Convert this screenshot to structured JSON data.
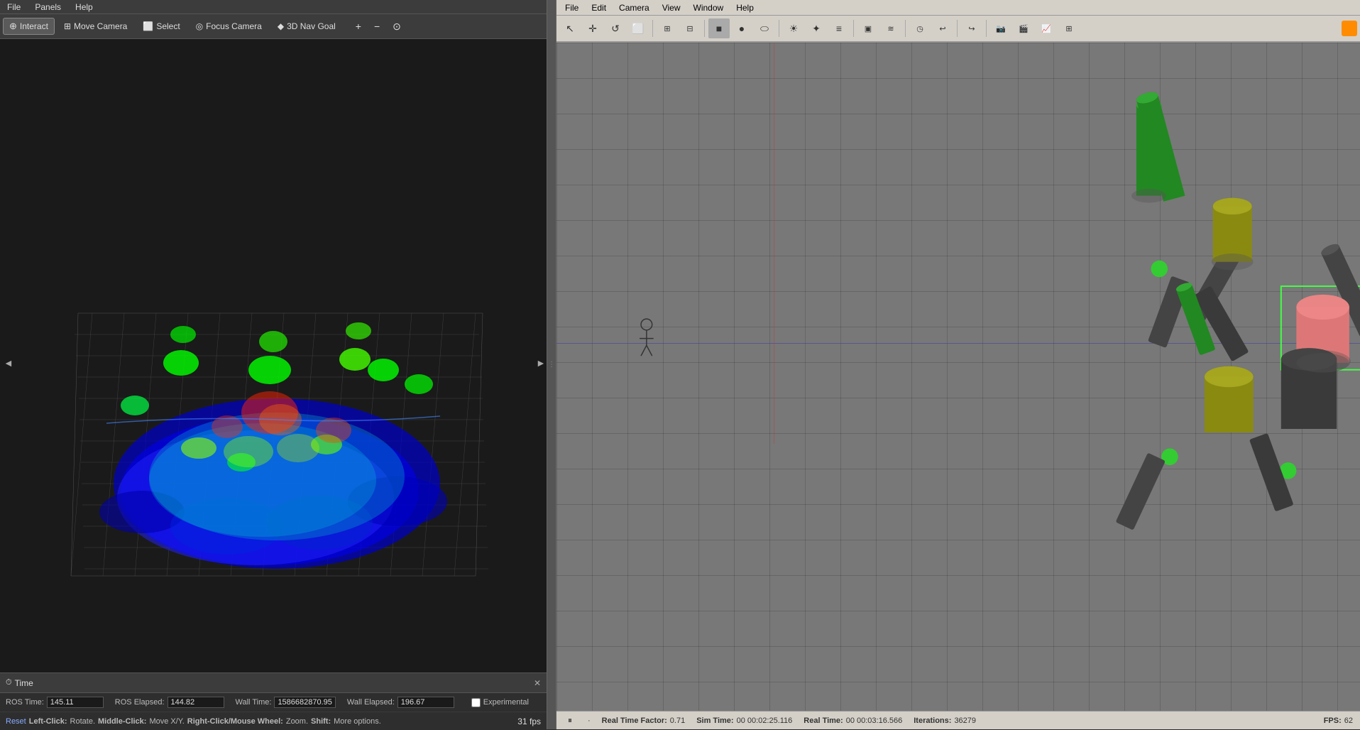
{
  "left": {
    "menubar": {
      "items": [
        "File",
        "Panels",
        "Help"
      ]
    },
    "toolbar": {
      "interact_label": "Interact",
      "move_camera_label": "Move Camera",
      "select_label": "Select",
      "focus_camera_label": "Focus Camera",
      "nav3d_label": "3D Nav Goal"
    },
    "viewport": {
      "side_arrow_left": "◄",
      "side_arrow_right": "►"
    },
    "time_panel": {
      "title": "Time",
      "close": "✕"
    },
    "status": {
      "ros_time_label": "ROS Time:",
      "ros_time_value": "145.11",
      "ros_elapsed_label": "ROS Elapsed:",
      "ros_elapsed_value": "144.82",
      "wall_time_label": "Wall Time:",
      "wall_time_value": "1586682870.95",
      "wall_elapsed_label": "Wall Elapsed:",
      "wall_elapsed_value": "196.67",
      "experimental_label": "Experimental"
    },
    "info": {
      "reset_label": "Reset",
      "hint_left": "Left-Click:",
      "hint_left_action": "Rotate.",
      "hint_middle": "Middle-Click:",
      "hint_middle_action": "Move X/Y.",
      "hint_right": "Right-Click/Mouse Wheel:",
      "hint_right_action": "Zoom.",
      "hint_shift": "Shift:",
      "hint_shift_action": "More options.",
      "fps": "31 fps"
    }
  },
  "right": {
    "menubar": {
      "items": [
        "File",
        "Edit",
        "Camera",
        "View",
        "Window",
        "Help"
      ]
    },
    "toolbar": {
      "tools": [
        "↖",
        "✛",
        "↺",
        "⬜",
        "|",
        "◀",
        "▶",
        "|",
        "●",
        "⬭",
        "☰",
        "|",
        "☀",
        "✦",
        "≡",
        "|",
        "▣",
        "≋",
        "|",
        "◷",
        "↩",
        "|",
        "↪"
      ],
      "orange": true
    },
    "status": {
      "pause_label": "⏸",
      "realtime_factor_label": "Real Time Factor:",
      "realtime_factor_value": "0.71",
      "sim_time_label": "Sim Time:",
      "sim_time_value": "00 00:02:25.116",
      "real_time_label": "Real Time:",
      "real_time_value": "00 00:03:16.566",
      "iterations_label": "Iterations:",
      "iterations_value": "36279",
      "fps_label": "FPS:",
      "fps_value": "62"
    }
  }
}
